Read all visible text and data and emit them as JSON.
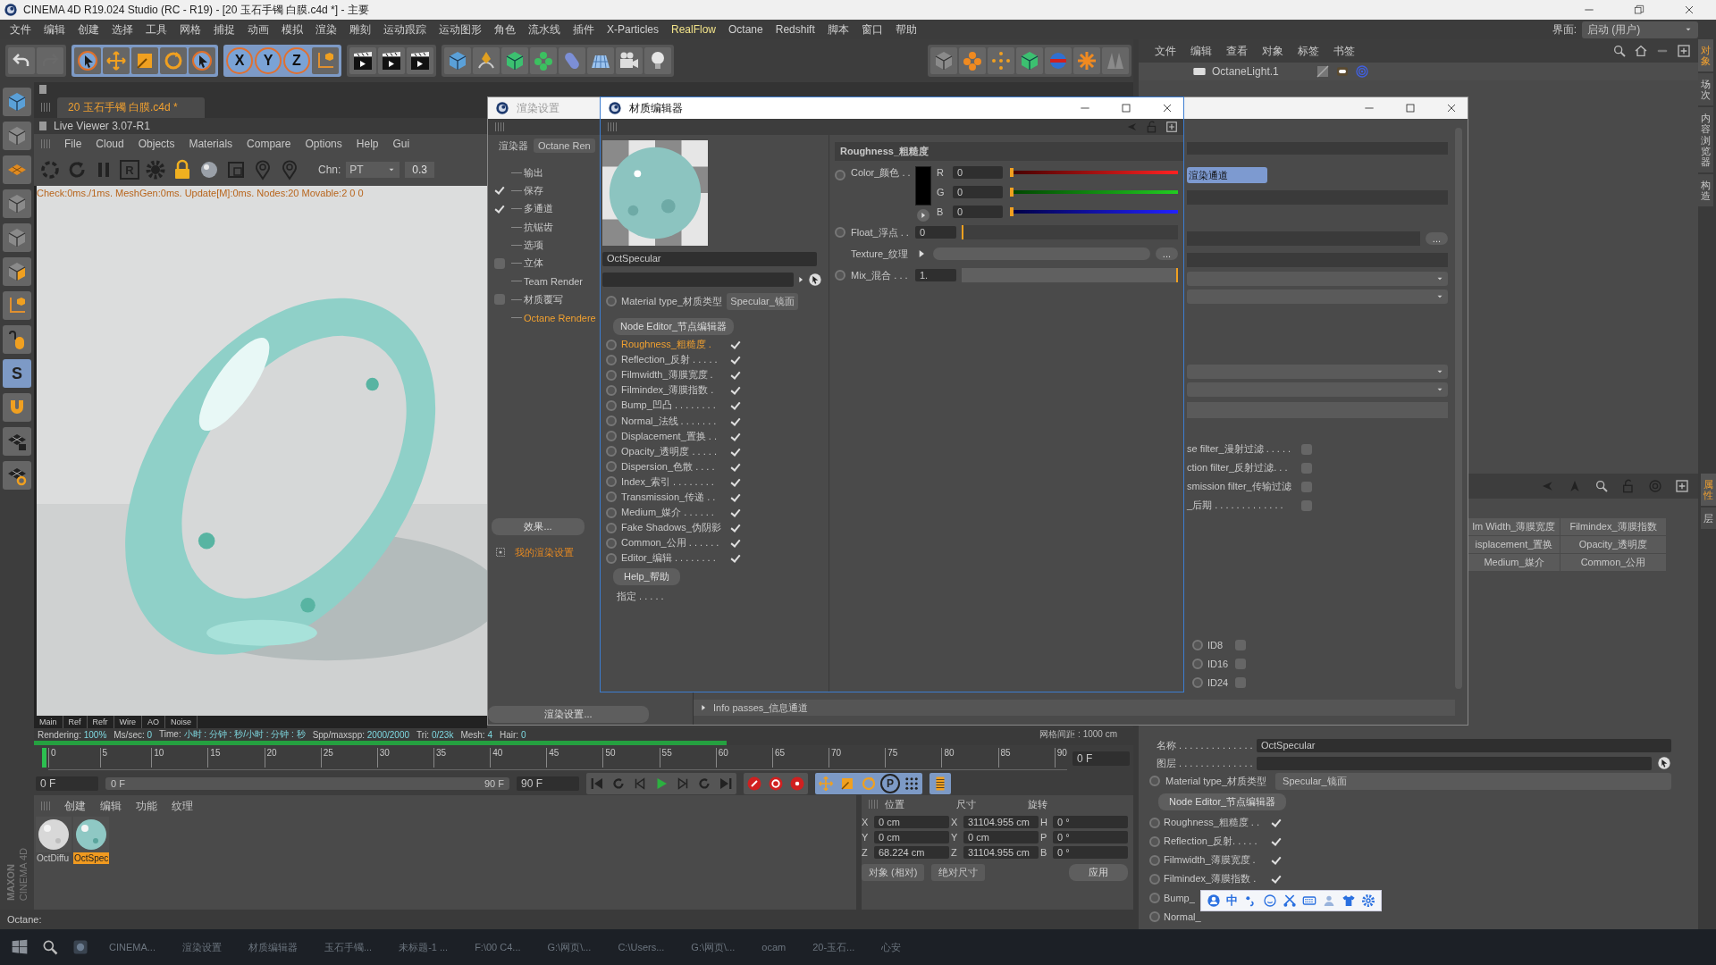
{
  "window": {
    "title": "CINEMA 4D R19.024 Studio (RC - R19) - [20 玉石手镯 白膜.c4d *] - 主要",
    "layout_label": "界面:",
    "layout_value": "启动 (用户)"
  },
  "menu": [
    {
      "label": "文件",
      "highlighted": false
    },
    {
      "label": "编辑",
      "highlighted": false
    },
    {
      "label": "创建",
      "highlighted": false
    },
    {
      "label": "选择",
      "highlighted": false
    },
    {
      "label": "工具",
      "highlighted": false
    },
    {
      "label": "网格",
      "highlighted": false
    },
    {
      "label": "捕捉",
      "highlighted": false
    },
    {
      "label": "动画",
      "highlighted": false
    },
    {
      "label": "模拟",
      "highlighted": false
    },
    {
      "label": "渲染",
      "highlighted": false
    },
    {
      "label": "雕刻",
      "highlighted": false
    },
    {
      "label": "运动跟踪",
      "highlighted": false
    },
    {
      "label": "运动图形",
      "highlighted": false
    },
    {
      "label": "角色",
      "highlighted": false
    },
    {
      "label": "流水线",
      "highlighted": false
    },
    {
      "label": "插件",
      "highlighted": false
    },
    {
      "label": "X-Particles",
      "highlighted": false
    },
    {
      "label": "RealFlow",
      "highlighted": true
    },
    {
      "label": "Octane",
      "highlighted": false
    },
    {
      "label": "Redshift",
      "highlighted": false
    },
    {
      "label": "脚本",
      "highlighted": false
    },
    {
      "label": "窗口",
      "highlighted": false
    },
    {
      "label": "帮助",
      "highlighted": false
    }
  ],
  "axis_buttons": [
    "X",
    "Y",
    "Z"
  ],
  "document_tab": "20 玉石手镯 白膜.c4d *",
  "tool_letter": "S",
  "live_viewer": {
    "title": "Live Viewer 3.07-R1",
    "menu": [
      "File",
      "Cloud",
      "Objects",
      "Materials",
      "Compare",
      "Options",
      "Help",
      "Gui"
    ],
    "render_letter": "R",
    "channel_label": "Chn:",
    "channel": "PT",
    "value": "0.3",
    "stats": "Check:0ms./1ms. MeshGen:0ms. Update[M]:0ms. Nodes:20 Movable:2  0 0",
    "tabs": [
      "Main",
      "Ref",
      "Refr",
      "Wire",
      "AO",
      "Noise"
    ],
    "render_stats": [
      {
        "label": "Rendering:",
        "value": "100%"
      },
      {
        "label": "Ms/sec:",
        "value": "0"
      },
      {
        "label": "Time:",
        "value": "小时 : 分钟 : 秒/小时 : 分钟 : 秒"
      },
      {
        "label": "Spp/maxspp:",
        "value": "2000/2000"
      },
      {
        "label": "Tri:",
        "value": "0/23k"
      },
      {
        "label": "Mesh:",
        "value": "4"
      },
      {
        "label": "Hair:",
        "value": "0"
      }
    ],
    "progress": {
      "level": 1
    }
  },
  "viewport": {
    "grid_spacing": "网格间距 : 1000 cm"
  },
  "timeline": {
    "ticks": [
      "0",
      "5",
      "10",
      "15",
      "20",
      "25",
      "30",
      "35",
      "40",
      "45",
      "50",
      "55",
      "60",
      "65",
      "70",
      "75",
      "80",
      "85",
      "90"
    ],
    "playhead": {
      "level": 0
    },
    "current_frame": "0 F",
    "start": "0 F",
    "range_start": "0 F",
    "range_end": "90 F",
    "end": "90 F",
    "tool_letter": "P"
  },
  "materials": {
    "menu": [
      "创建",
      "编辑",
      "功能",
      "纹理"
    ],
    "items": [
      {
        "name": "OctDiffu",
        "kind": "diffuse",
        "selected": false
      },
      {
        "name": "OctSpec",
        "kind": "specular",
        "selected": true
      }
    ]
  },
  "coordinates": {
    "headers": [
      "位置",
      "尺寸",
      "旋转"
    ],
    "rows": [
      {
        "p_axis": "X",
        "position": "0 cm",
        "s_axis": "X",
        "size": "31104.955 cm",
        "r_axis": "H",
        "rotation": "0 °"
      },
      {
        "p_axis": "Y",
        "position": "0 cm",
        "s_axis": "Y",
        "size": "0 cm",
        "r_axis": "P",
        "rotation": "0 °"
      },
      {
        "p_axis": "Z",
        "position": "68.224 cm",
        "s_axis": "Z",
        "size": "31104.955 cm",
        "r_axis": "B",
        "rotation": "0 °"
      }
    ],
    "mode": "对象 (相对)",
    "size_mode": "绝对尺寸",
    "apply": "应用"
  },
  "logo": [
    "MAXON",
    "CINEMA 4D"
  ],
  "status_bar": "Octane:",
  "taskbar": [
    "CINEMA...",
    "渲染设置",
    "材质编辑器",
    "玉石手镯...",
    "未标题-1 ...",
    "F:\\00 C4...",
    "G:\\网页\\...",
    "C:\\Users...",
    "G:\\网页\\...",
    "ocam",
    "20-玉石...",
    "心安"
  ],
  "object_manager": {
    "menu": [
      "文件",
      "编辑",
      "查看",
      "对象",
      "标签",
      "书签"
    ],
    "objects": [
      {
        "name": "OctaneLight.1"
      }
    ],
    "side_tabs": [
      {
        "label": "对象",
        "selected": true
      },
      {
        "label": "场次",
        "selected": false
      },
      {
        "label": "内容浏览器",
        "selected": false
      },
      {
        "label": "构造",
        "selected": false
      }
    ]
  },
  "attributes": {
    "side_tabs": [
      {
        "label": "属性",
        "selected": true
      },
      {
        "label": "层",
        "selected": false
      }
    ],
    "tabs": [
      "lm Width_薄膜宽度",
      "Filmindex_薄膜指数",
      "isplacement_置换",
      "Opacity_透明度",
      "Medium_媒介",
      "Common_公用"
    ],
    "name_label": "名称 . . . . . . . . . . . . . .",
    "name": "OctSpecular",
    "layer_label": "图层 . . . . . . . . . . . . . .",
    "material_type_label": "Material type_材质类型",
    "material_type": "Specular_镜面",
    "node_editor": "Node Editor_节点编辑器",
    "channels": [
      {
        "label": "Roughness_粗糙度 . .",
        "checked": true
      },
      {
        "label": "Reflection_反射. . . . .",
        "checked": true
      },
      {
        "label": "Filmwidth_薄膜宽度 .",
        "checked": true
      },
      {
        "label": "Filmindex_薄膜指数 .",
        "checked": true
      },
      {
        "label": "Bump_"
      },
      {
        "label": "Normal_"
      }
    ]
  },
  "render_settings": {
    "title": "渲染设置",
    "renderer_label": "渲染器",
    "renderer": "Octane Ren",
    "tree": [
      {
        "label": "输出",
        "kind": "plain",
        "selected": false
      },
      {
        "label": "保存",
        "kind": "check",
        "checked": true,
        "selected": false
      },
      {
        "label": "多通道",
        "kind": "check",
        "checked": true,
        "selected": false
      },
      {
        "label": "抗锯齿",
        "kind": "plain",
        "selected": false
      },
      {
        "label": "选项",
        "kind": "plain",
        "selected": false
      },
      {
        "label": "立体",
        "kind": "check",
        "checked": false,
        "selected": false
      },
      {
        "label": "Team Render",
        "kind": "plain",
        "selected": false
      },
      {
        "label": "材质覆写",
        "kind": "check",
        "checked": false,
        "selected": false
      },
      {
        "label": "Octane Rendere",
        "kind": "plain",
        "selected": true
      }
    ],
    "effects_button": "效果...",
    "preset": "我的渲染设置",
    "settings_button": "渲染设置...",
    "pass_button": "渲染通道",
    "browse_button": "...",
    "filters": [
      {
        "label": "se filter_漫射过滤 . . . . .",
        "checked": false
      },
      {
        "label": "ction filter_反射过滤. . .",
        "checked": false
      },
      {
        "label": "smission filter_传输过滤",
        "checked": false
      },
      {
        "label": "_后期 . . . . . . . . . . . . .",
        "checked": false
      }
    ],
    "ids": [
      {
        "label": "ID8",
        "checked": false
      },
      {
        "label": "ID16",
        "checked": false
      },
      {
        "label": "ID24",
        "checked": false
      }
    ],
    "info_passes": "Info passes_信息通道"
  },
  "material_editor": {
    "title": "材质编辑器",
    "name": "OctSpecular",
    "material_type_label": "Material type_材质类型",
    "material_type": "Specular_镜面",
    "node_editor": "Node Editor_节点编辑器",
    "channels": [
      {
        "label": "Roughness_粗糙度 .",
        "checked": true,
        "selected": true
      },
      {
        "label": "Reflection_反射 . . . . .",
        "checked": true,
        "selected": false
      },
      {
        "label": "Filmwidth_薄膜宽度 .",
        "checked": true,
        "selected": false
      },
      {
        "label": "Filmindex_薄膜指数 .",
        "checked": true,
        "selected": false
      },
      {
        "label": "Bump_凹凸 . . . . . . . .",
        "checked": true,
        "selected": false
      },
      {
        "label": "Normal_法线 . . . . . . .",
        "checked": true,
        "selected": false
      },
      {
        "label": "Displacement_置换 . .",
        "checked": true,
        "selected": false
      },
      {
        "label": "Opacity_透明度 . . . . .",
        "checked": true,
        "selected": false
      },
      {
        "label": "Dispersion_色散 . . . .",
        "checked": true,
        "selected": false
      },
      {
        "label": "Index_索引 . . . . . . . .",
        "checked": true,
        "selected": false
      },
      {
        "label": "Transmission_传递 . .",
        "checked": true,
        "selected": false
      },
      {
        "label": "Medium_媒介 . . . . . .",
        "checked": true,
        "selected": false
      },
      {
        "label": "Fake Shadows_伪阴影",
        "checked": true,
        "selected": false
      },
      {
        "label": "Common_公用 . . . . . .",
        "checked": true,
        "selected": false
      },
      {
        "label": "Editor_编辑 . . . . . . . .",
        "checked": true,
        "selected": false
      }
    ],
    "help": "Help_帮助",
    "assign": "指定 . . . . .",
    "section": "Roughness_粗糙度",
    "color_label": "Color_颜色 . .",
    "rgb": [
      {
        "label": "R",
        "value": "0",
        "level": 0
      },
      {
        "label": "G",
        "value": "0",
        "level": 0
      },
      {
        "label": "B",
        "value": "0",
        "level": 0
      }
    ],
    "float_label": "Float_浮点 . .",
    "float": {
      "value": "0",
      "level": 0
    },
    "texture_label": "Texture_纹理",
    "browse_button": "...",
    "mix_label": "Mix_混合 . . .",
    "mix": {
      "value": "1.",
      "level": 1
    }
  },
  "ime_toolbar": {
    "mode": "中"
  }
}
